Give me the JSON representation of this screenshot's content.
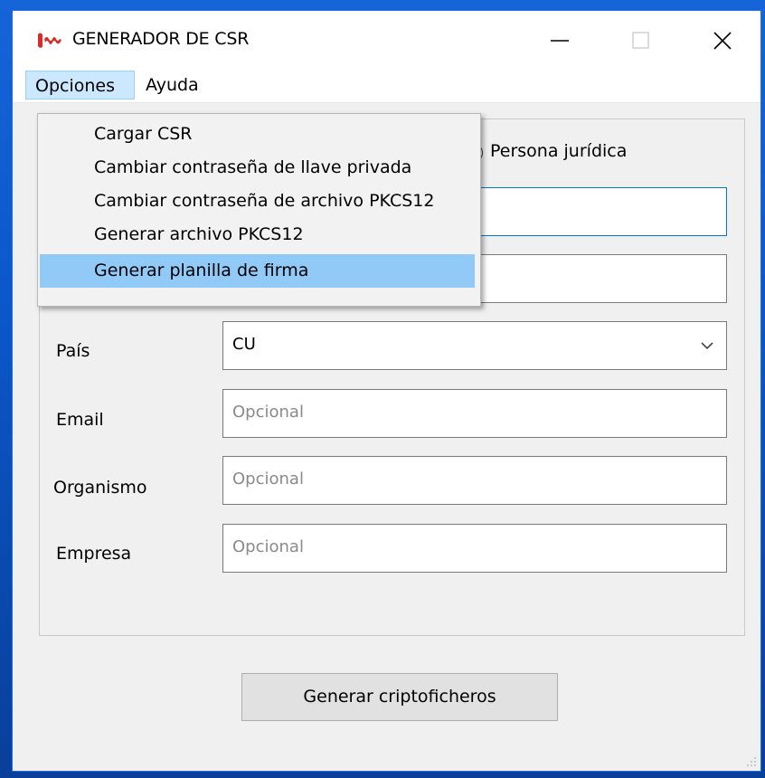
{
  "window": {
    "title": "GENERADOR DE CSR",
    "controls": {
      "minimize": "minimize-icon",
      "maximize": "maximize-icon",
      "close": "close-icon"
    }
  },
  "menubar": {
    "items": [
      {
        "label": "Opciones",
        "active": true
      },
      {
        "label": "Ayuda",
        "active": false
      }
    ]
  },
  "dropdown": {
    "items": [
      {
        "label": "Cargar CSR",
        "highlighted": false
      },
      {
        "label": "Cambiar contraseña de llave privada",
        "highlighted": false
      },
      {
        "label": "Cambiar contraseña de archivo PKCS12",
        "highlighted": false
      },
      {
        "label": "Generar archivo PKCS12",
        "highlighted": false
      },
      {
        "label": "Generar planilla de firma",
        "highlighted": true
      }
    ]
  },
  "form": {
    "radio_persona_juridica": "Persona jurídica",
    "pais": {
      "label": "País",
      "value": "CU"
    },
    "email": {
      "label": "Email",
      "placeholder": "Opcional"
    },
    "organismo": {
      "label": "Organismo",
      "placeholder": "Opcional"
    },
    "empresa": {
      "label": "Empresa",
      "placeholder": "Opcional"
    }
  },
  "actions": {
    "generate_label": "Generar criptoficheros"
  },
  "colors": {
    "highlight": "#91c9f7",
    "focus_border": "#0078d7",
    "menu_active": "#cce8ff"
  }
}
